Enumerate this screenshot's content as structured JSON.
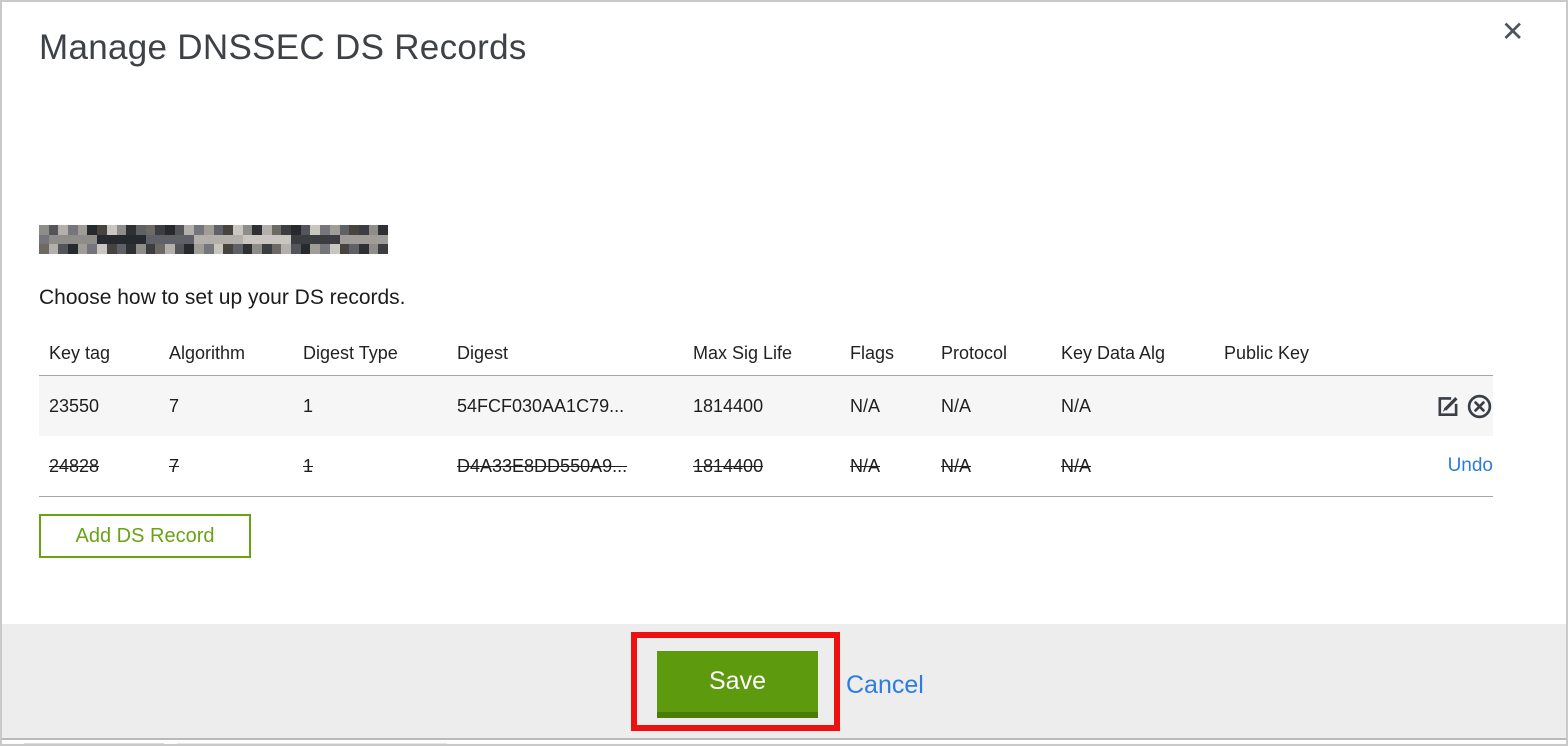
{
  "modal": {
    "title": "Manage DNSSEC DS Records",
    "close_glyph": "✕"
  },
  "instruction": "Choose how to set up your DS records.",
  "redacted_domain": {
    "rows": 3,
    "cols": 36,
    "palette": [
      "#8f8d8a",
      "#3c3d41",
      "#6d6a66",
      "#b3b0ab",
      "#54555b",
      "#262a2e",
      "#a09d99",
      "#75767c",
      "#c9c6c1",
      "#47443f",
      "#5f6167",
      "#2f3033"
    ]
  },
  "table": {
    "columns": [
      "Key tag",
      "Algorithm",
      "Digest Type",
      "Digest",
      "Max Sig Life",
      "Flags",
      "Protocol",
      "Key Data Alg",
      "Public Key"
    ],
    "rows": [
      {
        "key_tag": "23550",
        "algorithm": "7",
        "digest_type": "1",
        "digest": "54FCF030AA1C79...",
        "max_sig_life": "1814400",
        "flags": "N/A",
        "protocol": "N/A",
        "key_data_alg": "N/A",
        "public_key": "",
        "state": "active"
      },
      {
        "key_tag": "24828",
        "algorithm": "7",
        "digest_type": "1",
        "digest": "D4A33E8DD550A9...",
        "max_sig_life": "1814400",
        "flags": "N/A",
        "protocol": "N/A",
        "key_data_alg": "N/A",
        "public_key": "",
        "state": "deleted",
        "action_label": "Undo"
      }
    ]
  },
  "buttons": {
    "add_ds_record": "Add DS Record",
    "save": "Save",
    "cancel": "Cancel"
  },
  "colors": {
    "save_green": "#5d9a0e",
    "save_green_dark": "#4a7c08",
    "outline_green": "#69a314",
    "link_blue": "#2d7ce0",
    "annotation_red": "#ee1111",
    "footer_bg": "#ededed",
    "row_alt_bg": "#f6f6f6"
  }
}
